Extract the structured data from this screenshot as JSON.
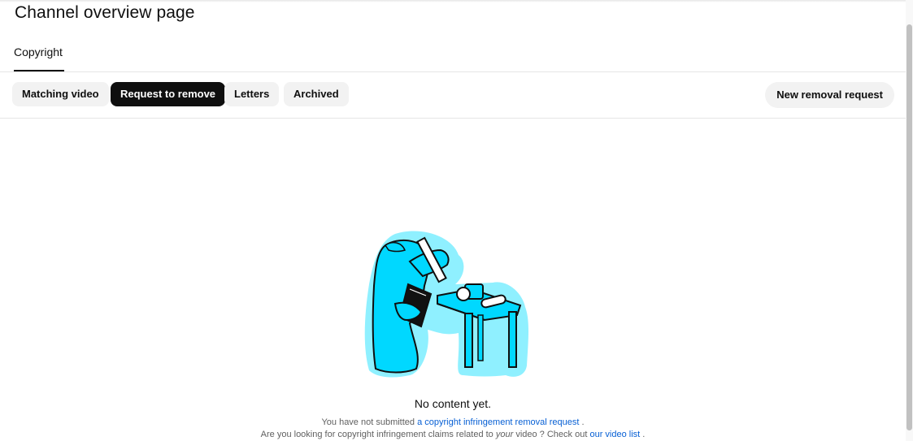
{
  "page": {
    "title": "Channel overview page"
  },
  "tabs": [
    {
      "label": "Copyright",
      "active": true
    }
  ],
  "chips": [
    {
      "label": "Matching video",
      "selected": false
    },
    {
      "label": "Request to remove",
      "selected": true
    },
    {
      "label": "Letters",
      "selected": false
    },
    {
      "label": "Archived",
      "selected": false
    }
  ],
  "actions": {
    "new_removal_request_label": "New removal request"
  },
  "empty_state": {
    "title": "No content yet.",
    "line1_prefix": "You have not submitted",
    "line1_link": "a copyright infringement removal request",
    "line1_suffix": ".",
    "line2_prefix": "Are you looking for copyright infringement claims related to",
    "line2_emphasis": "your",
    "line2_middle": "video ? Check out",
    "line2_link": "our video list",
    "line2_suffix": "."
  },
  "colors": {
    "illustration_fill": "#00d8ff",
    "illustration_halo": "#8ff0ff",
    "selected_chip": "#0f0f0f",
    "link": "#065fd4"
  }
}
